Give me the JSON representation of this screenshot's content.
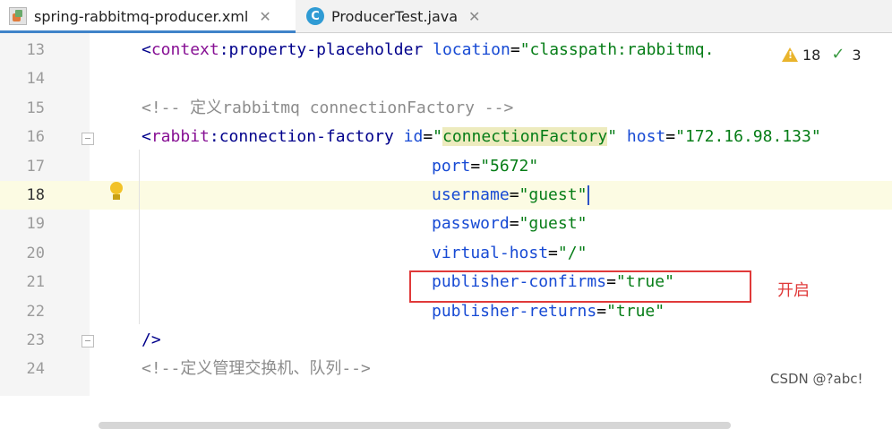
{
  "tabs": [
    {
      "label": "spring-rabbitmq-producer.xml",
      "icon": "xml-file-icon",
      "active": true
    },
    {
      "label": "ProducerTest.java",
      "icon": "java-class-icon",
      "active": false
    }
  ],
  "inspections": {
    "warnings": "18",
    "weak_warnings": "3"
  },
  "lines": [
    {
      "num": "13"
    },
    {
      "num": "14"
    },
    {
      "num": "15"
    },
    {
      "num": "16"
    },
    {
      "num": "17"
    },
    {
      "num": "18"
    },
    {
      "num": "19"
    },
    {
      "num": "20"
    },
    {
      "num": "21"
    },
    {
      "num": "22"
    },
    {
      "num": "23"
    },
    {
      "num": "24"
    }
  ],
  "code": {
    "l13": {
      "open": "<",
      "ns": "context",
      "colon": ":",
      "tag": "property-placeholder",
      "attr": " location",
      "eq": "=",
      "val": "\"classpath:rabbitmq."
    },
    "l15": {
      "text": "<!-- 定义rabbitmq connectionFactory -->"
    },
    "l16": {
      "open": "<",
      "ns": "rabbit",
      "colon": ":",
      "tag": "connection-factory",
      "attr1": " id",
      "eq1": "=",
      "q1": "\"",
      "val1": "connectionFactory",
      "q1e": "\"",
      "attr2": " host",
      "eq2": "=",
      "val2": "\"172.16.98.133\""
    },
    "l17": {
      "attr": "port",
      "eq": "=",
      "val": "\"5672\""
    },
    "l18": {
      "attr": "username",
      "eq": "=",
      "val": "\"guest\""
    },
    "l19": {
      "attr": "password",
      "eq": "=",
      "val": "\"guest\""
    },
    "l20": {
      "attr": "virtual-host",
      "eq": "=",
      "val": "\"/\""
    },
    "l21": {
      "attr": "publisher-confirms",
      "eq": "=",
      "val": "\"true\""
    },
    "l22": {
      "attr": "publisher-returns",
      "eq": "=",
      "val": "\"true\""
    },
    "l23": {
      "text": "/>"
    },
    "l24": {
      "text": "<!--定义管理交换机、队列-->"
    }
  },
  "annotation": "开启",
  "watermark": "CSDN @?abc!"
}
